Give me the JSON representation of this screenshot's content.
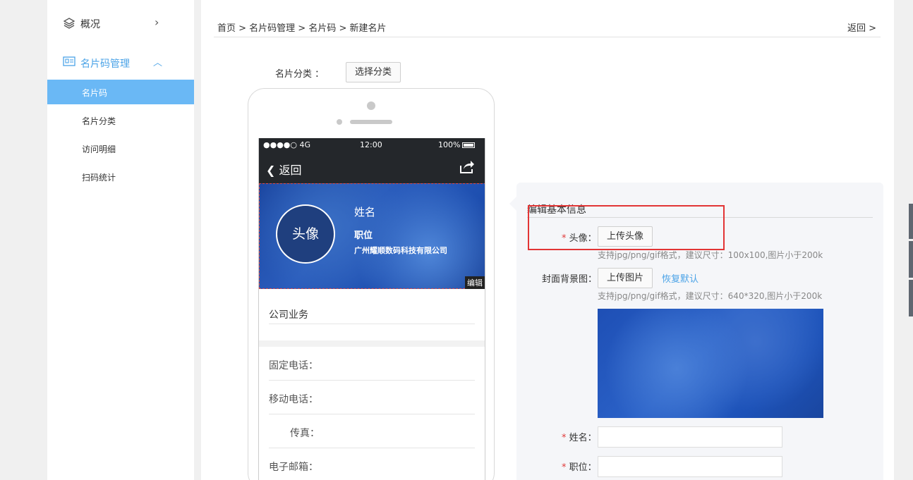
{
  "sidebar": {
    "overview_label": "概况",
    "group_label": "名片码管理",
    "items": [
      {
        "label": "名片码",
        "active": true
      },
      {
        "label": "名片分类",
        "active": false
      },
      {
        "label": "访问明细",
        "active": false
      },
      {
        "label": "扫码统计",
        "active": false
      }
    ]
  },
  "breadcrumb": "首页 > 名片码管理 > 名片码 > 新建名片",
  "back_link": "返回 >",
  "category": {
    "label": "名片分类 ：",
    "button": "选择分类"
  },
  "phone": {
    "status": {
      "signal": "●●●●○ 4G",
      "time": "12:00",
      "battery": "100%"
    },
    "nav_back": "返回",
    "card": {
      "avatar_text": "头像",
      "name": "姓名",
      "position": "职位",
      "company": "广州耀顺数码科技有限公司",
      "edit": "编辑"
    },
    "section_title": "公司业务",
    "fields": [
      "固定电话：",
      "移动电话：",
      "传真：",
      "电子邮箱："
    ]
  },
  "form": {
    "title": "编辑基本信息",
    "avatar_label": "头像：",
    "avatar_button": "上传头像",
    "avatar_hint": "支持jpg/png/gif格式，建议尺寸：100x100,图片小于200k",
    "cover_label": "封面背景图：",
    "cover_button": "上传图片",
    "cover_reset": "恢复默认",
    "cover_hint": "支持jpg/png/gif格式，建议尺寸：640*320,图片小于200k",
    "name_label": "姓名：",
    "position_label": "职位：",
    "required_mark": "*"
  },
  "colors": {
    "accent": "#4ba3e7",
    "active_item": "#6ab8f5",
    "required": "#e03b3b",
    "highlight_box": "#e23535"
  }
}
